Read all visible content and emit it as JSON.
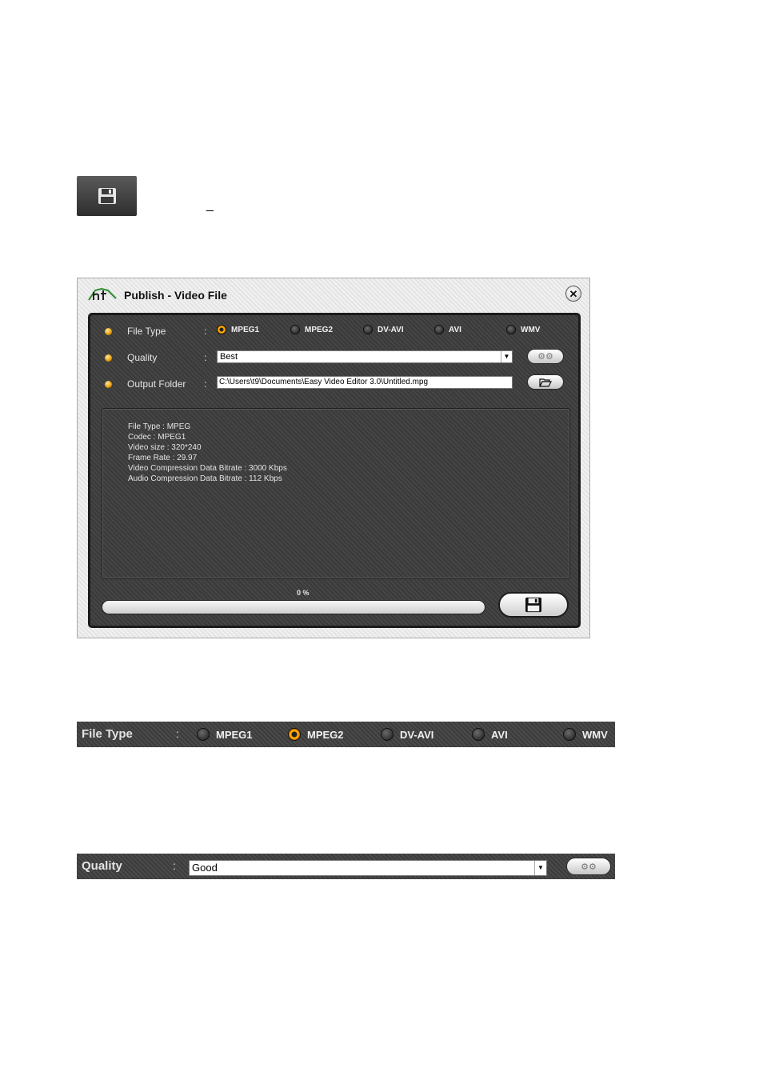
{
  "dialog": {
    "title": "Publish - Video File",
    "close_glyph": "✕",
    "labels": {
      "file_type": "File Type",
      "quality": "Quality",
      "output_folder": "Output Folder",
      "colon": ":"
    },
    "file_types": [
      {
        "label": "MPEG1",
        "selected": true
      },
      {
        "label": "MPEG2",
        "selected": false
      },
      {
        "label": "DV-AVI",
        "selected": false
      },
      {
        "label": "AVI",
        "selected": false
      },
      {
        "label": "WMV",
        "selected": false
      }
    ],
    "quality_value": "Best",
    "output_path": "C:\\Users\\t9\\Documents\\Easy Video Editor 3.0\\Untitled.mpg",
    "info_lines": [
      "File Type : MPEG",
      "Codec : MPEG1",
      "Video size : 320*240",
      "Frame Rate : 29.97",
      "Video Compression Data Bitrate : 3000 Kbps",
      "Audio Compression Data Bitrate : 112 Kbps"
    ],
    "progress_text": "0 %",
    "progress_fraction": 0
  },
  "file_type_strip": {
    "label": "File Type",
    "colon": ":",
    "options": [
      {
        "label": "MPEG1",
        "selected": false
      },
      {
        "label": "MPEG2",
        "selected": true
      },
      {
        "label": "DV-AVI",
        "selected": false
      },
      {
        "label": "AVI",
        "selected": false
      },
      {
        "label": "WMV",
        "selected": false
      }
    ]
  },
  "quality_strip": {
    "label": "Quality",
    "colon": ":",
    "value": "Good"
  },
  "misc": {
    "dash": "_"
  },
  "colors": {
    "accent": "#ff9e00",
    "panel": "#404040"
  }
}
